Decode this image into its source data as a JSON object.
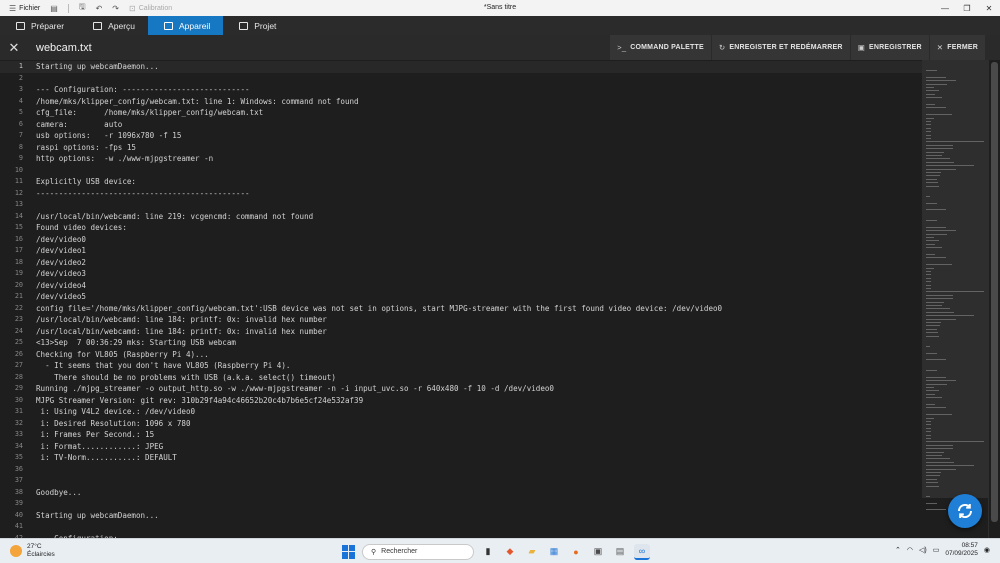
{
  "titlebar": {
    "menu_label": "Fichier",
    "calibration_label": "Calibration",
    "window_title": "*Sans titre"
  },
  "nav": {
    "tabs": [
      {
        "label": "Préparer",
        "icon": "cube-icon",
        "active": false
      },
      {
        "label": "Aperçu",
        "icon": "preview-icon",
        "active": false
      },
      {
        "label": "Appareil",
        "icon": "device-icon",
        "active": true
      },
      {
        "label": "Projet",
        "icon": "project-icon",
        "active": false
      }
    ],
    "active_color": "#1677c2"
  },
  "editor_header": {
    "file_name": "webcam.txt",
    "command_palette_label": "COMMAND PALETTE",
    "save_restart_label": "ENREGISTER ET REDÉMARRER",
    "save_label": "ENREGISTRER",
    "close_label": "FERMER"
  },
  "editor": {
    "current_line": 1,
    "lines": [
      "Starting up webcamDaemon...",
      "",
      "--- Configuration: ----------------------------",
      "/home/mks/klipper_config/webcam.txt: line 1: Windows: command not found",
      "cfg_file:      /home/mks/klipper_config/webcam.txt",
      "camera:        auto",
      "usb options:   -r 1096x780 -f 15",
      "raspi options: -fps 15",
      "http options:  -w ./www-mjpgstreamer -n",
      "",
      "Explicitly USB device:",
      "-----------------------------------------------",
      "",
      "/usr/local/bin/webcamd: line 219: vcgencmd: command not found",
      "Found video devices:",
      "/dev/video0",
      "/dev/video1",
      "/dev/video2",
      "/dev/video3",
      "/dev/video4",
      "/dev/video5",
      "config file='/home/mks/klipper_config/webcam.txt':USB device was not set in options, start MJPG-streamer with the first found video device: /dev/video0",
      "/usr/local/bin/webcamd: line 184: printf: 0x: invalid hex number",
      "/usr/local/bin/webcamd: line 184: printf: 0x: invalid hex number",
      "<13>Sep  7 00:36:29 mks: Starting USB webcam",
      "Checking for VL805 (Raspberry Pi 4)...",
      "  - It seems that you don't have VL805 (Raspberry Pi 4).",
      "    There should be no problems with USB (a.k.a. select() timeout)",
      "Running ./mjpg_streamer -o output_http.so -w ./www-mjpgstreamer -n -i input_uvc.so -r 640x480 -f 10 -d /dev/video0",
      "MJPG Streamer Version: git rev: 310b29f4a94c46652b20c4b7b6e5cf24e532af39",
      " i: Using V4L2 device.: /dev/video0",
      " i: Desired Resolution: 1096 x 780",
      " i: Frames Per Second.: 15",
      " i: Format............: JPEG",
      " i: TV-Norm...........: DEFAULT",
      "",
      "",
      "Goodbye...",
      "",
      "Starting up webcamDaemon...",
      "",
      "--- Configuration: ----------------------------"
    ]
  },
  "taskbar": {
    "temperature": "27°C",
    "weather_text": "Éclaircies",
    "search_placeholder": "Rechercher",
    "time": "08:57",
    "date": "07/09/2025",
    "apps": [
      "file-explorer-icon",
      "brave-icon",
      "folder-icon",
      "store-icon",
      "firefox-icon",
      "photos-icon",
      "calculator-icon",
      "orca-slicer-icon"
    ]
  }
}
